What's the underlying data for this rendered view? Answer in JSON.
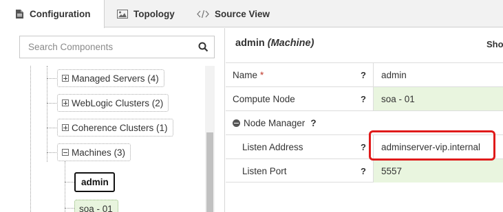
{
  "tabs": [
    {
      "label": "Configuration",
      "icon": "document-icon",
      "active": true
    },
    {
      "label": "Topology",
      "icon": "image-icon",
      "active": false
    },
    {
      "label": "Source View",
      "icon": "code-icon",
      "active": false
    }
  ],
  "search": {
    "placeholder": "Search Components",
    "icon": "search-icon"
  },
  "tree": {
    "items": [
      {
        "label": "Managed Servers (4)",
        "toggle": "plus"
      },
      {
        "label": "WebLogic Clusters (2)",
        "toggle": "plus"
      },
      {
        "label": "Coherence Clusters (1)",
        "toggle": "plus"
      },
      {
        "label": "Machines (3)",
        "toggle": "minus"
      },
      {
        "label": "admin",
        "selected": true
      },
      {
        "label": "soa - 01"
      }
    ]
  },
  "detail": {
    "title_name": "admin",
    "title_type": "(Machine)",
    "show_label": "Sho",
    "help_symbol": "?",
    "required_marker": "*",
    "rows": [
      {
        "label": "Name",
        "value": "admin"
      },
      {
        "label": "Compute Node",
        "value": "soa - 01"
      },
      {
        "label": "Node Manager"
      },
      {
        "label": "Listen Address",
        "value": "adminserver-vip.internal"
      },
      {
        "label": "Listen Port",
        "value": "5557"
      }
    ]
  },
  "colors": {
    "highlight": "#e01a1a",
    "value_green": "#e9f5df",
    "required": "#c0392b"
  }
}
